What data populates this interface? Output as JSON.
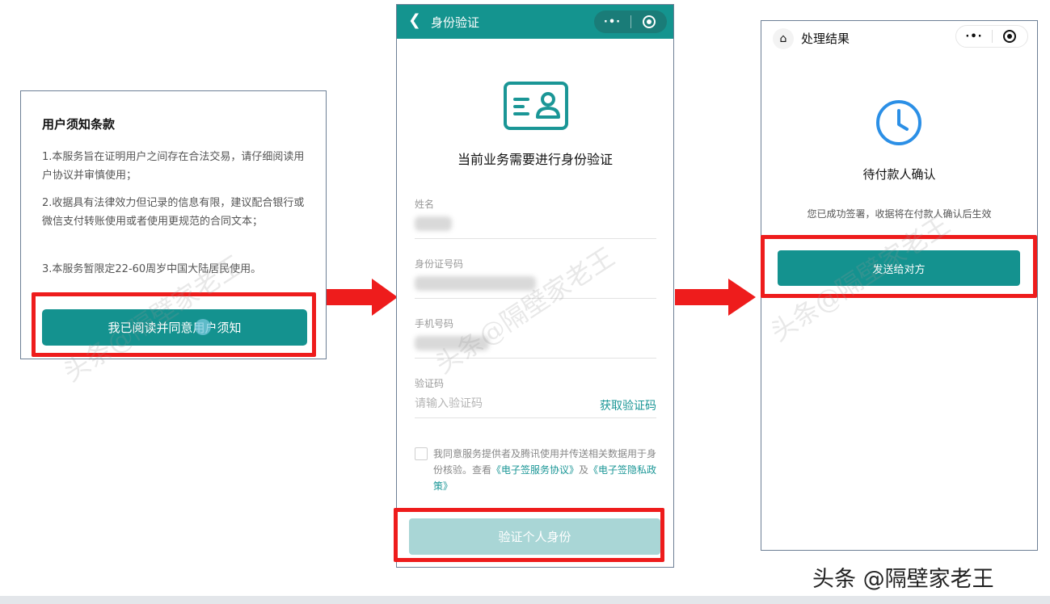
{
  "terms": {
    "title": "用户须知条款",
    "items": [
      "1.本服务旨在证明用户之间存在合法交易，请仔细阅读用户协议并审慎使用；",
      "2.收据具有法律效力但记录的信息有限，建议配合银行或微信支付转账使用或者使用更规范的合同文本；",
      "3.本服务暂限定22-60周岁中国大陆居民使用。"
    ],
    "agree_button": "我已阅读并同意用户须知"
  },
  "verify": {
    "nav_title": "身份验证",
    "back_icon": "back-chevron-icon",
    "more_label": "·•·",
    "heading": "当前业务需要进行身份验证",
    "fields": {
      "name_label": "姓名",
      "id_label": "身份证号码",
      "phone_label": "手机号码",
      "code_label": "验证码",
      "code_placeholder": "请输入验证码",
      "get_code": "获取验证码"
    },
    "consent": {
      "text": "我同意服务提供者及腾讯使用并传送相关数据用于身份核验。查看",
      "link1": "《电子签服务协议》",
      "and": "及",
      "link2": "《电子签隐私政策》"
    },
    "submit_button": "验证个人身份"
  },
  "result": {
    "nav_title": "处理结果",
    "more_label": "·•·",
    "status": "待付款人确认",
    "description": "您已成功签署，收据将在付款人确认后生效",
    "send_button": "发送给对方"
  },
  "watermark": "头条@隔壁家老王",
  "credit": "头条 @隔壁家老王",
  "colors": {
    "accent": "#14928f",
    "disabled_button": "#a9d6d6",
    "highlight_red": "#ee1c1c",
    "clock_blue": "#2b8fe6"
  }
}
